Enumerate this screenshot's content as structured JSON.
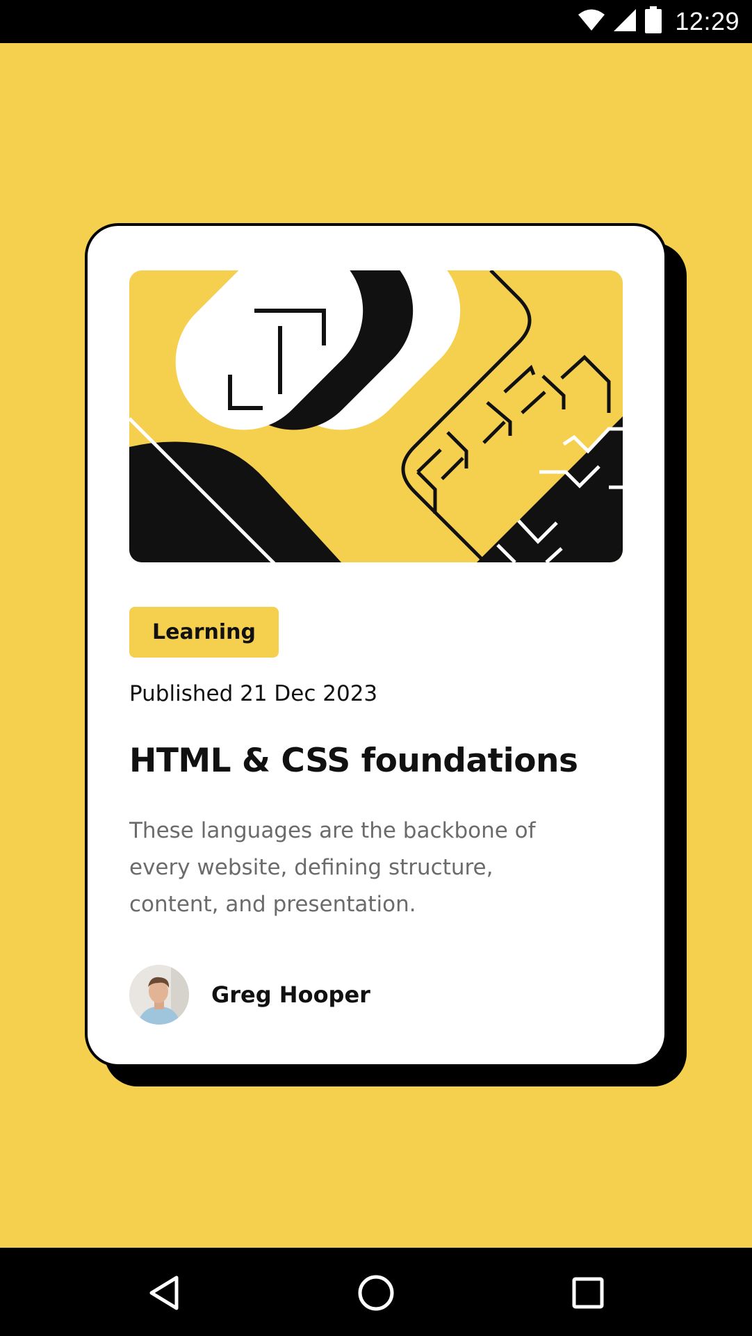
{
  "status_bar": {
    "time": "12:29",
    "icons": [
      "wifi-icon",
      "cell-signal-icon",
      "battery-icon"
    ]
  },
  "card": {
    "tag": "Learning",
    "published": "Published 21 Dec 2023",
    "title": "HTML & CSS foundations",
    "description": "These languages are the backbone of every website, defining structure, content, and presentation.",
    "author": {
      "name": "Greg Hooper"
    }
  },
  "colors": {
    "background": "#f4d04e",
    "card": "#ffffff",
    "text": "#111111",
    "muted_text": "#6b6b6b",
    "shadow": "#000000"
  },
  "nav_bar": {
    "buttons": [
      "back-icon",
      "home-icon",
      "recents-icon"
    ]
  }
}
